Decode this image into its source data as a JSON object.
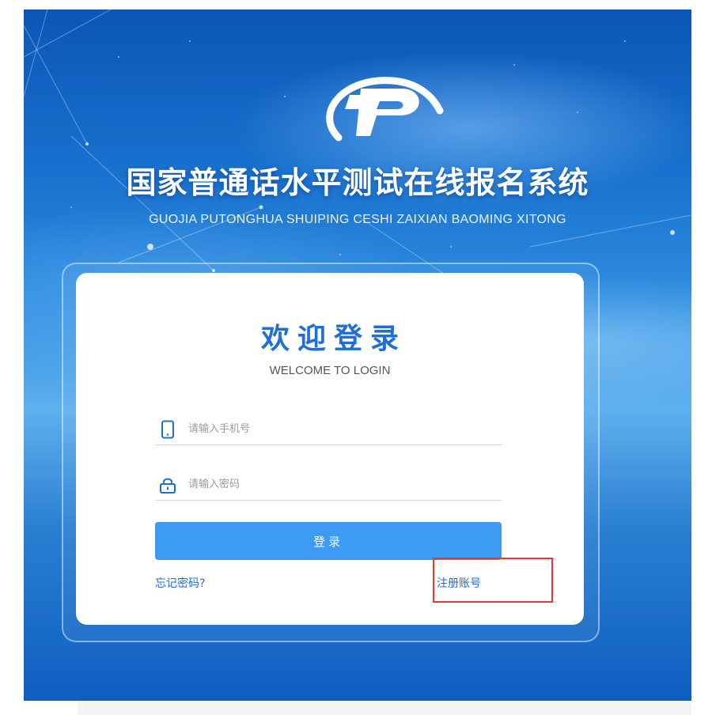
{
  "header": {
    "title": "国家普通话水平测试在线报名系统",
    "subtitle": "GUOJIA PUTONGHUA SHUIPING CESHI ZAIXIAN BAOMING XITONG"
  },
  "login": {
    "title": "欢迎登录",
    "subtitle": "WELCOME TO LOGIN",
    "phone": {
      "placeholder": "请输入手机号",
      "value": "",
      "icon": "phone-icon"
    },
    "password": {
      "placeholder": "请输入密码",
      "value": "",
      "icon": "lock-icon"
    },
    "submit_label": "登录",
    "forgot_label": "忘记密码?",
    "register_label": "注册账号"
  },
  "colors": {
    "brand": "#1f6fd6",
    "button": "#3d9bf3",
    "highlight": "#e53935"
  }
}
